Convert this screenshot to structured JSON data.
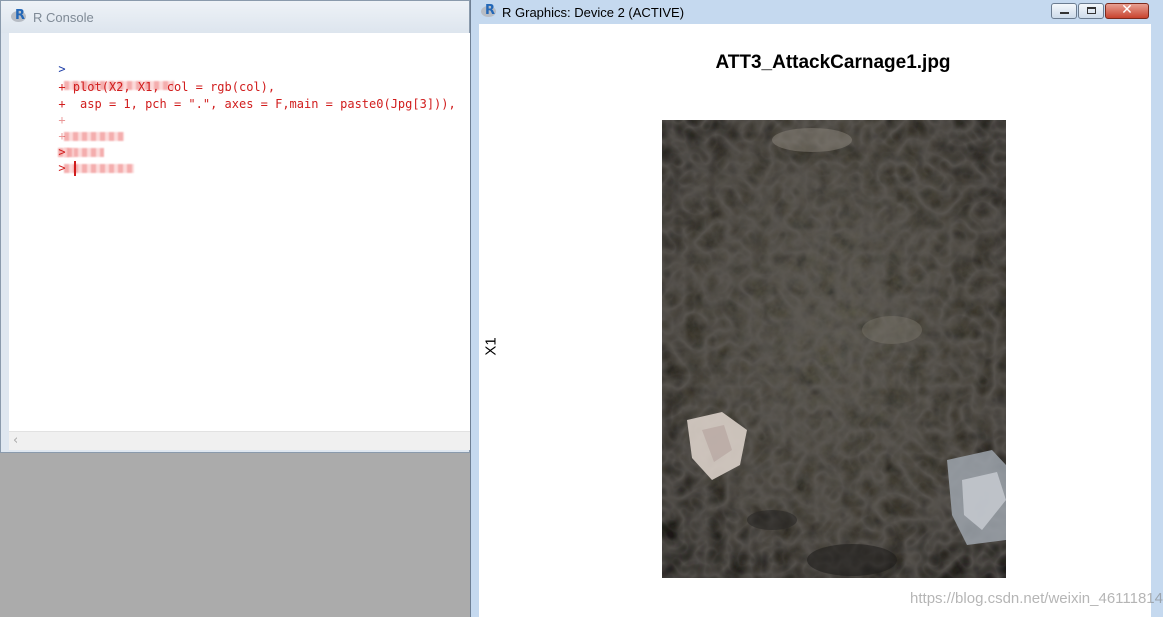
{
  "console": {
    "title": "R Console",
    "lines": [
      {
        "prompt": ">",
        "text": ""
      },
      {
        "prompt": "+",
        "text": " plot(X2, X1, col = rgb(col),"
      },
      {
        "prompt": "+",
        "text": "  asp = 1, pch = \".\", axes = F,main = paste0(Jpg[3])),"
      },
      {
        "prompt": "+",
        "text": ""
      },
      {
        "prompt": "+",
        "text": ""
      },
      {
        "prompt": ">",
        "text": ""
      },
      {
        "prompt": ">",
        "text": ""
      }
    ]
  },
  "graphics": {
    "title": "R Graphics: Device 2 (ACTIVE)",
    "plot_title": "ATT3_AttackCarnage1.jpg",
    "y_label": "X1",
    "image_description": "photo of a pile of dead bees"
  },
  "watermark": "https://blog.csdn.net/weixin_46111814",
  "colors": {
    "console_code": "#d11d1d",
    "console_prompt": "#1f3fa8",
    "title_bar": "#c5d9ef",
    "close_button": "#c8432e"
  },
  "icons": [
    "r-logo-icon",
    "minimize-icon",
    "maximize-icon",
    "close-icon",
    "scroll-left-icon"
  ]
}
